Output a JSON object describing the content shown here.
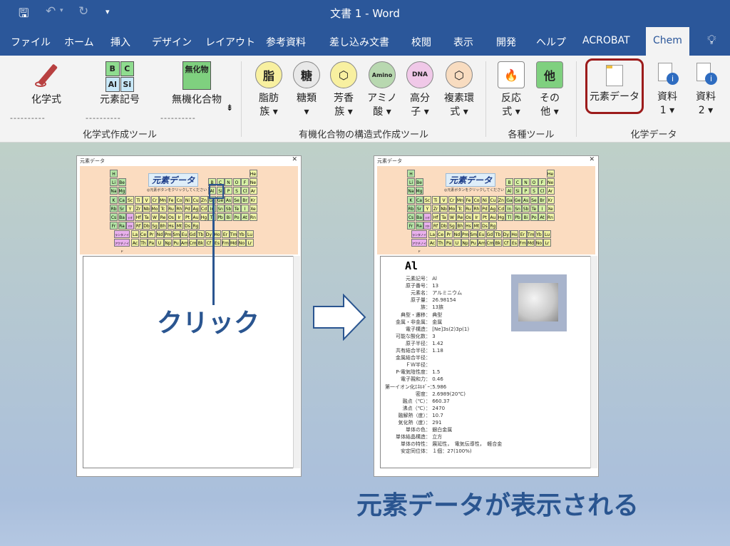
{
  "window": {
    "title": "文書 1  -  Word"
  },
  "tabs": [
    "ファイル",
    "ホーム",
    "挿入",
    "デザイン",
    "レイアウト",
    "参考資料",
    "差し込み文書",
    "校閲",
    "表示",
    "開発",
    "ヘルプ",
    "ACROBAT",
    "Chem"
  ],
  "ribbon": {
    "g1": {
      "label": "化学式作成ツール",
      "kagaku": "化学式",
      "genso": "元素記号",
      "muki": "無機化合物",
      "sym": [
        "B",
        "C",
        "Al",
        "Si"
      ],
      "mukiIcon": "無化物"
    },
    "g2": {
      "label": "有機化合物の構造式作成ツール",
      "items": [
        {
          "icon": "脂",
          "l1": "脂肪",
          "l2": "族"
        },
        {
          "icon": "糖",
          "l1": "糖類",
          "l2": ""
        },
        {
          "icon": "⬡",
          "l1": "芳香",
          "l2": "族"
        },
        {
          "icon": "Amino",
          "l1": "アミノ",
          "l2": "酸"
        },
        {
          "icon": "DNA",
          "l1": "高分",
          "l2": "子"
        },
        {
          "icon": "⬡",
          "l1": "複素環",
          "l2": "式"
        }
      ]
    },
    "g3": {
      "label": "各種ツール",
      "items": [
        {
          "icon": "🔥",
          "l1": "反応",
          "l2": "式"
        },
        {
          "icon": "他",
          "l1": "その",
          "l2": "他"
        }
      ]
    },
    "g4": {
      "label": "化学データ",
      "genso": "元素データ",
      "shiryo1": "資料",
      "shiryo1n": "1",
      "shiryo2": "資料",
      "shiryo2n": "2"
    }
  },
  "dialog": {
    "title": "元素データ",
    "header": "元素データ",
    "instruction": "◎元素ボタンをクリックしてください",
    "lanthanoid": "ランタノイド",
    "actinoid": "アクチノイド",
    "elements": [
      [
        "H",
        1,
        1
      ],
      [
        "He",
        1,
        18
      ],
      [
        "Li",
        2,
        1
      ],
      [
        "Be",
        2,
        2
      ],
      [
        "B",
        2,
        13
      ],
      [
        "C",
        2,
        14
      ],
      [
        "N",
        2,
        15
      ],
      [
        "O",
        2,
        16
      ],
      [
        "F",
        2,
        17
      ],
      [
        "Ne",
        2,
        18
      ],
      [
        "Na",
        3,
        1
      ],
      [
        "Mg",
        3,
        2
      ],
      [
        "Al",
        3,
        13
      ],
      [
        "Si",
        3,
        14
      ],
      [
        "P",
        3,
        15
      ],
      [
        "S",
        3,
        16
      ],
      [
        "Cl",
        3,
        17
      ],
      [
        "Ar",
        3,
        18
      ],
      [
        "K",
        4,
        1
      ],
      [
        "Ca",
        4,
        2
      ],
      [
        "Sc",
        4,
        3
      ],
      [
        "Ti",
        4,
        4
      ],
      [
        "V",
        4,
        5
      ],
      [
        "Cr",
        4,
        6
      ],
      [
        "Mn",
        4,
        7
      ],
      [
        "Fe",
        4,
        8
      ],
      [
        "Co",
        4,
        9
      ],
      [
        "Ni",
        4,
        10
      ],
      [
        "Cu",
        4,
        11
      ],
      [
        "Zn",
        4,
        12
      ],
      [
        "Ga",
        4,
        13
      ],
      [
        "Ge",
        4,
        14
      ],
      [
        "As",
        4,
        15
      ],
      [
        "Se",
        4,
        16
      ],
      [
        "Br",
        4,
        17
      ],
      [
        "Kr",
        4,
        18
      ],
      [
        "Rb",
        5,
        1
      ],
      [
        "Sr",
        5,
        2
      ],
      [
        "Y",
        5,
        3
      ],
      [
        "Zr",
        5,
        4
      ],
      [
        "Nb",
        5,
        5
      ],
      [
        "Mo",
        5,
        6
      ],
      [
        "Tc",
        5,
        7
      ],
      [
        "Ru",
        5,
        8
      ],
      [
        "Rh",
        5,
        9
      ],
      [
        "Pd",
        5,
        10
      ],
      [
        "Ag",
        5,
        11
      ],
      [
        "Cd",
        5,
        12
      ],
      [
        "In",
        5,
        13
      ],
      [
        "Sn",
        5,
        14
      ],
      [
        "Sb",
        5,
        15
      ],
      [
        "Te",
        5,
        16
      ],
      [
        "I",
        5,
        17
      ],
      [
        "Xe",
        5,
        18
      ],
      [
        "Cs",
        6,
        1
      ],
      [
        "Ba",
        6,
        2
      ],
      [
        "Hf",
        6,
        4
      ],
      [
        "Ta",
        6,
        5
      ],
      [
        "W",
        6,
        6
      ],
      [
        "Re",
        6,
        7
      ],
      [
        "Os",
        6,
        8
      ],
      [
        "Ir",
        6,
        9
      ],
      [
        "Pt",
        6,
        10
      ],
      [
        "Au",
        6,
        11
      ],
      [
        "Hg",
        6,
        12
      ],
      [
        "Tl",
        6,
        13
      ],
      [
        "Pb",
        6,
        14
      ],
      [
        "Bi",
        6,
        15
      ],
      [
        "Po",
        6,
        16
      ],
      [
        "At",
        6,
        17
      ],
      [
        "Rn",
        6,
        18
      ],
      [
        "Fr",
        7,
        1
      ],
      [
        "Ra",
        7,
        2
      ],
      [
        "Rf",
        7,
        4
      ],
      [
        "Db",
        7,
        5
      ],
      [
        "Sg",
        7,
        6
      ],
      [
        "Bh",
        7,
        7
      ],
      [
        "Hs",
        7,
        8
      ],
      [
        "Mt",
        7,
        9
      ],
      [
        "Ds",
        7,
        10
      ],
      [
        "Rg",
        7,
        11
      ]
    ],
    "lanth": [
      "La",
      "Ce",
      "Pr",
      "Nd",
      "Pm",
      "Sm",
      "Eu",
      "Gd",
      "Tb",
      "Dy",
      "Ho",
      "Er",
      "Tm",
      "Yb",
      "Lu"
    ],
    "actin": [
      "Ac",
      "Th",
      "Pa",
      "U",
      "Np",
      "Pu",
      "Am",
      "Cm",
      "Bk",
      "Cf",
      "Es",
      "Fm",
      "Md",
      "No",
      "Lr"
    ],
    "colors": {
      "s": "#b5e5a5",
      "p": "#d6f0a4",
      "d": "#f2f2a4",
      "noble": "#f0f6a8",
      "f": "#eef0a0",
      "rare": "#e8b0ec"
    }
  },
  "detail": {
    "symbol": "Al",
    "props": [
      [
        "元素記号",
        "Al"
      ],
      [
        "原子番号",
        "13"
      ],
      [
        "元素名",
        "アルミニウム"
      ],
      [
        "原子量",
        "26.98154"
      ],
      [
        "族",
        "13族"
      ],
      [
        "典型・遷移",
        "典型"
      ],
      [
        "金属・非金属",
        "金属"
      ],
      [
        "電子構造",
        "[Ne]3s(2)3p(1)"
      ],
      [
        "可能な酸化数",
        "3"
      ],
      [
        "原子半径",
        "1.42"
      ],
      [
        "共有結合半径",
        "1.18"
      ],
      [
        "金属結合半径",
        ""
      ],
      [
        "ＦＷ半径",
        ""
      ],
      [
        "P-電気陰性度",
        "1.5"
      ],
      [
        "電子親和力",
        "0.46"
      ],
      [
        "第一イオン化ｴﾈﾙｷﾞｰ",
        "5.986"
      ],
      [
        "密度",
        "2.6989(20℃)"
      ],
      [
        "融点（℃）",
        "660.37"
      ],
      [
        "沸点（℃）",
        "2470"
      ],
      [
        "融解熱（度）",
        "10.7"
      ],
      [
        "気化熱（度）",
        "291"
      ],
      [
        "単体の色",
        "銀白金属"
      ],
      [
        "単体結晶構造",
        "立方"
      ],
      [
        "単体の特性",
        "展延性，　電気伝導性，　軽合金"
      ],
      [
        "安定同位体",
        "１個：27(100%)"
      ]
    ]
  },
  "annotations": {
    "click": "クリック",
    "result": "元素データが表示される"
  },
  "accents": {
    "titlebar": "#2b579a",
    "highlight": "#9c1b1b",
    "annotation": "#2a5590"
  }
}
